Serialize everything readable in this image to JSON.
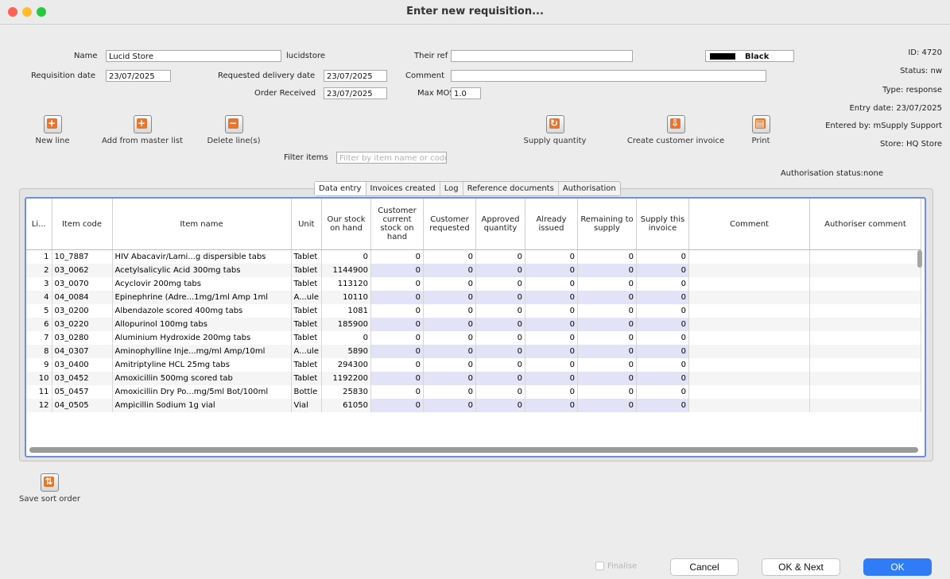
{
  "window": {
    "title": "Enter new requisition..."
  },
  "form": {
    "name_label": "Name",
    "name_value": "Lucid Store",
    "name_code": "lucidstore",
    "their_ref_label": "Their ref",
    "their_ref_value": "",
    "color_value": "Black",
    "req_date_label": "Requisition date",
    "req_date_value": "23/07/2025",
    "req_delivery_label": "Requested delivery date",
    "req_delivery_value": "23/07/2025",
    "comment_label": "Comment",
    "comment_value": "",
    "order_received_label": "Order Received",
    "order_received_value": "23/07/2025",
    "max_mos_label": "Max MOS",
    "max_mos_value": "1.0",
    "filter_label": "Filter items",
    "filter_placeholder": "Filter by item name or code"
  },
  "info": {
    "id": "ID: 4720",
    "status": "Status: nw",
    "type": "Type: response",
    "entry_date": "Entry date: 23/07/2025",
    "entered_by": "Entered by: mSupply Support",
    "store": "Store: HQ Store",
    "authorisation": "Authorisation status:none"
  },
  "toolbar": {
    "new_line": "New line",
    "add_master": "Add from master list",
    "delete_lines": "Delete line(s)",
    "supply_qty": "Supply quantity",
    "create_invoice": "Create customer invoice",
    "print": "Print",
    "save_sort": "Save sort order"
  },
  "tabs": [
    "Data entry",
    "Invoices created",
    "Log",
    "Reference documents",
    "Authorisation"
  ],
  "columns": [
    "Li...",
    "Item code",
    "Item name",
    "Unit",
    "Our stock on hand",
    "Customer current stock on hand",
    "Customer requested",
    "Approved quantity",
    "Already issued",
    "Remaining to supply",
    "Supply this invoice",
    "Comment",
    "Authoriser comment"
  ],
  "rows": [
    [
      "1",
      "10_7887",
      "HIV Abacavir/Lami...g dispersible tabs",
      "Tablet",
      "0",
      "0",
      "0",
      "0",
      "0",
      "0",
      "0",
      "",
      ""
    ],
    [
      "2",
      "03_0062",
      "Acetylsalicylic Acid 300mg tabs",
      "Tablet",
      "1144900",
      "0",
      "0",
      "0",
      "0",
      "0",
      "0",
      "",
      ""
    ],
    [
      "3",
      "03_0070",
      "Acyclovir 200mg tabs",
      "Tablet",
      "113120",
      "0",
      "0",
      "0",
      "0",
      "0",
      "0",
      "",
      ""
    ],
    [
      "4",
      "04_0084",
      "Epinephrine (Adre...1mg/1ml Amp 1ml",
      "A...ule",
      "10110",
      "0",
      "0",
      "0",
      "0",
      "0",
      "0",
      "",
      ""
    ],
    [
      "5",
      "03_0200",
      "Albendazole scored 400mg tabs",
      "Tablet",
      "1081",
      "0",
      "0",
      "0",
      "0",
      "0",
      "0",
      "",
      ""
    ],
    [
      "6",
      "03_0220",
      "Allopurinol 100mg tabs",
      "Tablet",
      "185900",
      "0",
      "0",
      "0",
      "0",
      "0",
      "0",
      "",
      ""
    ],
    [
      "7",
      "03_0280",
      "Aluminium Hydroxide 200mg tabs",
      "Tablet",
      "0",
      "0",
      "0",
      "0",
      "0",
      "0",
      "0",
      "",
      ""
    ],
    [
      "8",
      "04_0307",
      "Aminophylline Inje...mg/ml Amp/10ml",
      "A...ule",
      "5890",
      "0",
      "0",
      "0",
      "0",
      "0",
      "0",
      "",
      ""
    ],
    [
      "9",
      "03_0400",
      "Amitriptyline HCL 25mg tabs",
      "Tablet",
      "294300",
      "0",
      "0",
      "0",
      "0",
      "0",
      "0",
      "",
      ""
    ],
    [
      "10",
      "03_0452",
      "Amoxicillin 500mg scored tab",
      "Tablet",
      "1192200",
      "0",
      "0",
      "0",
      "0",
      "0",
      "0",
      "",
      ""
    ],
    [
      "11",
      "05_0457",
      "Amoxicillin Dry Po...mg/5ml Bot/100ml",
      "Bottle",
      "25830",
      "0",
      "0",
      "0",
      "0",
      "0",
      "0",
      "",
      ""
    ],
    [
      "12",
      "04_0505",
      "Ampicillin Sodium 1g vial",
      "Vial",
      "61050",
      "0",
      "0",
      "0",
      "0",
      "0",
      "0",
      "",
      ""
    ]
  ],
  "footer": {
    "finalise": "Finalise",
    "cancel": "Cancel",
    "ok_next": "OK & Next",
    "ok": "OK"
  }
}
